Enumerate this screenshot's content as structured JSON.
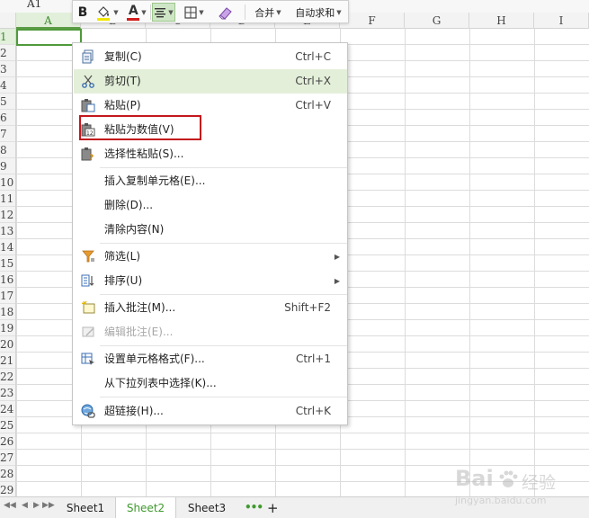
{
  "name_box": "A1",
  "columns": [
    "A",
    "B",
    "C",
    "D",
    "E",
    "F",
    "G",
    "H",
    "I"
  ],
  "rows": [
    "1",
    "2",
    "3",
    "4",
    "5",
    "6",
    "7",
    "8",
    "9",
    "10",
    "11",
    "12",
    "13",
    "14",
    "15",
    "16",
    "17",
    "18",
    "19",
    "20",
    "21",
    "22",
    "23",
    "24",
    "25",
    "26",
    "27",
    "28",
    "29"
  ],
  "toolbar": {
    "bold": "B",
    "font_color": "A",
    "merge_label": "合并",
    "autosum_label": "自动求和"
  },
  "menu": {
    "items": [
      {
        "label": "复制(C)",
        "shortcut": "Ctrl+C",
        "icon": "copy-icon"
      },
      {
        "label": "剪切(T)",
        "shortcut": "Ctrl+X",
        "icon": "scissors-icon"
      },
      {
        "label": "粘贴(P)",
        "shortcut": "Ctrl+V",
        "icon": "paste-icon"
      },
      {
        "label": "粘贴为数值(V)",
        "shortcut": "",
        "icon": "paste-values-icon"
      },
      {
        "label": "选择性粘贴(S)...",
        "shortcut": "",
        "icon": "paste-special-icon"
      },
      {
        "label": "插入复制单元格(E)...",
        "shortcut": "",
        "icon": ""
      },
      {
        "label": "删除(D)...",
        "shortcut": "",
        "icon": ""
      },
      {
        "label": "清除内容(N)",
        "shortcut": "",
        "icon": ""
      },
      {
        "label": "筛选(L)",
        "shortcut": "",
        "icon": "filter-icon"
      },
      {
        "label": "排序(U)",
        "shortcut": "",
        "icon": "sort-icon"
      },
      {
        "label": "插入批注(M)...",
        "shortcut": "Shift+F2",
        "icon": "insert-comment-icon"
      },
      {
        "label": "编辑批注(E)...",
        "shortcut": "",
        "icon": "edit-comment-icon"
      },
      {
        "label": "设置单元格格式(F)...",
        "shortcut": "Ctrl+1",
        "icon": "format-cells-icon"
      },
      {
        "label": "从下拉列表中选择(K)...",
        "shortcut": "",
        "icon": ""
      },
      {
        "label": "超链接(H)...",
        "shortcut": "Ctrl+K",
        "icon": "hyperlink-icon"
      }
    ]
  },
  "sheets": [
    "Sheet1",
    "Sheet2",
    "Sheet3"
  ],
  "active_sheet": "Sheet2",
  "watermark": {
    "brand": "Bai",
    "brand_cn": "经验",
    "url": "jingyan.baidu.com"
  },
  "colors": {
    "accent_green": "#3f9a2d",
    "highlight_red": "#c3171d",
    "hover_green": "#e3efd9"
  }
}
